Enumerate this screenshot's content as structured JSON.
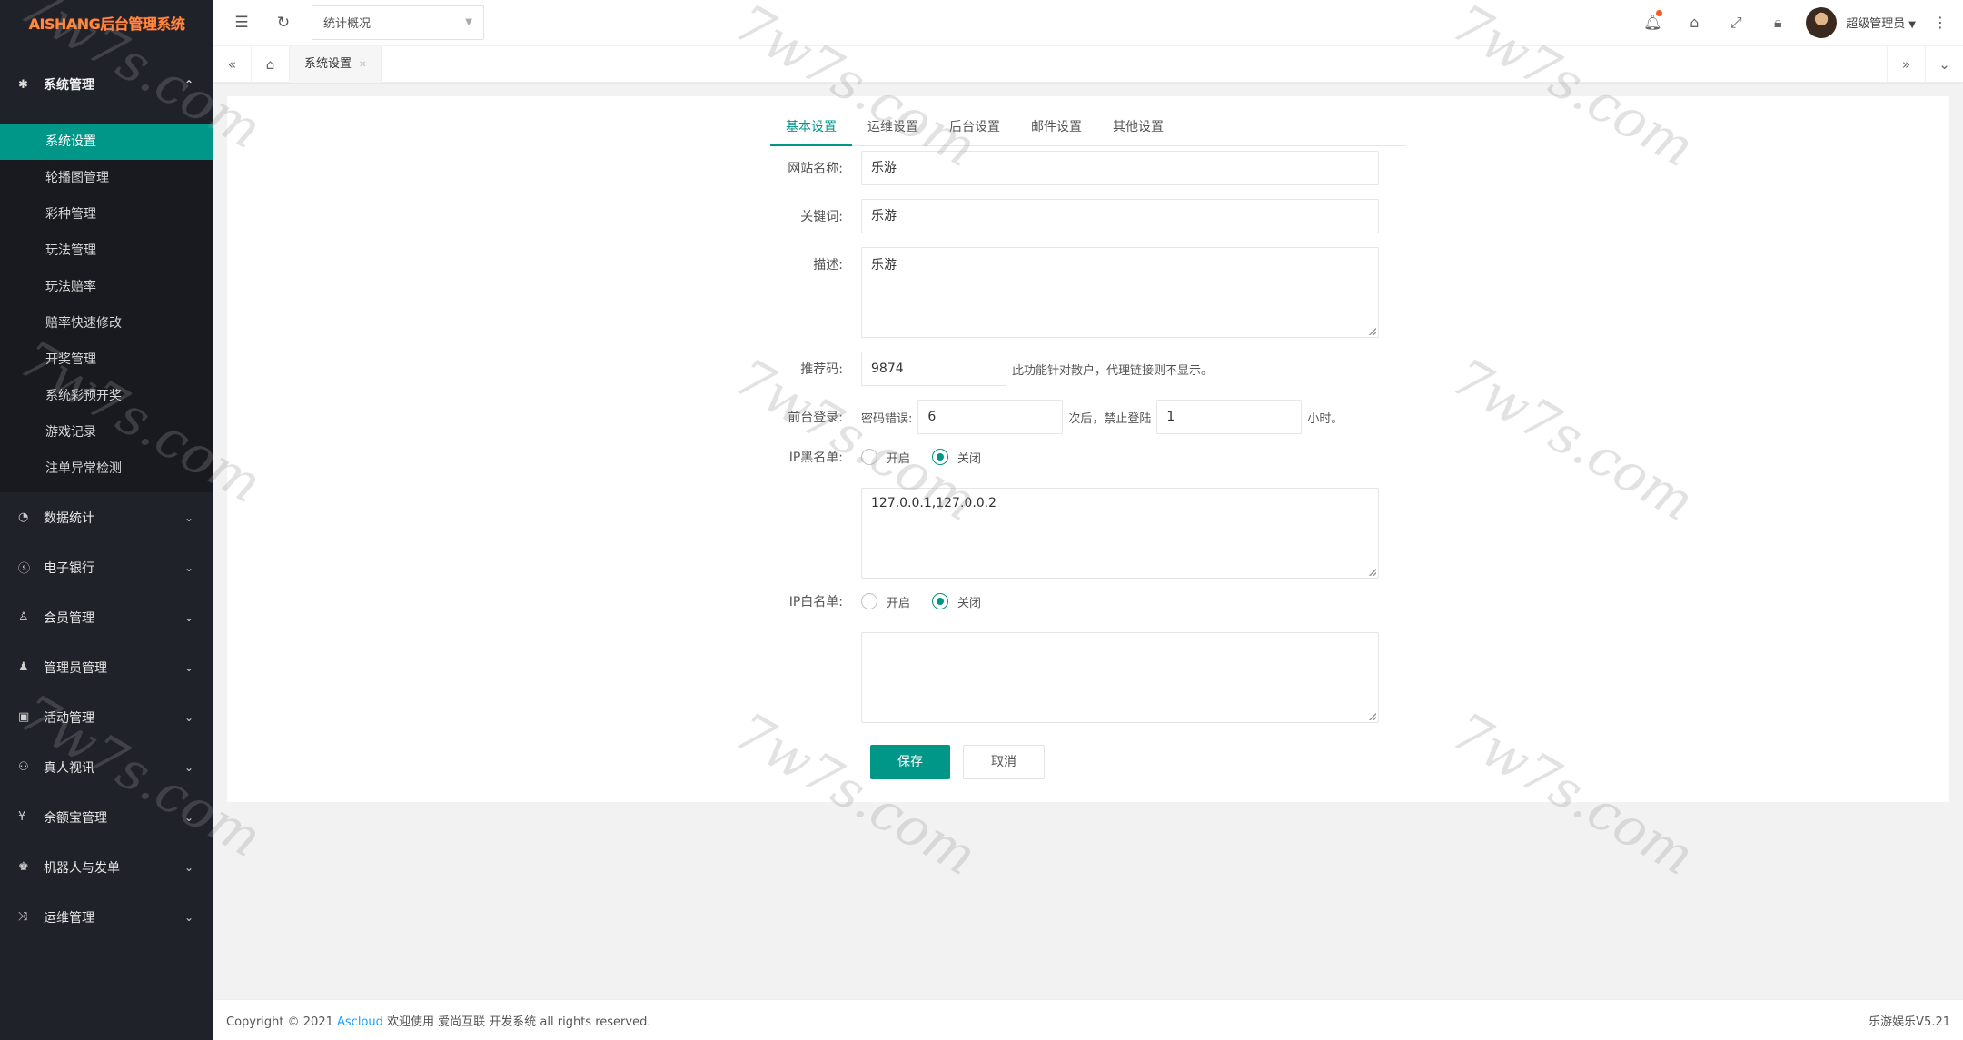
{
  "brand": {
    "logo_text": "AISHANG后台管理系统"
  },
  "sidebar": {
    "open_group": {
      "label": "系统管理",
      "icon": "gear-icon"
    },
    "sub_items": [
      {
        "label": "系统设置",
        "active": true
      },
      {
        "label": "轮播图管理"
      },
      {
        "label": "彩种管理"
      },
      {
        "label": "玩法管理"
      },
      {
        "label": "玩法赔率"
      },
      {
        "label": "赔率快速修改"
      },
      {
        "label": "开奖管理"
      },
      {
        "label": "系统彩预开奖"
      },
      {
        "label": "游戏记录"
      },
      {
        "label": "注单异常检测"
      }
    ],
    "groups": [
      {
        "label": "数据统计",
        "icon": "dashboard-icon"
      },
      {
        "label": "电子银行",
        "icon": "dollar-icon"
      },
      {
        "label": "会员管理",
        "icon": "users-icon"
      },
      {
        "label": "管理员管理",
        "icon": "user-icon"
      },
      {
        "label": "活动管理",
        "icon": "gift-icon"
      },
      {
        "label": "真人视讯",
        "icon": "group-icon"
      },
      {
        "label": "余额宝管理",
        "icon": "yen-icon"
      },
      {
        "label": "机器人与发单",
        "icon": "robot-icon"
      },
      {
        "label": "运维管理",
        "icon": "shuffle-icon"
      }
    ]
  },
  "header": {
    "select_value": "统计概况",
    "username": "超级管理员"
  },
  "tabbar": {
    "tab_label": "系统设置"
  },
  "form": {
    "tabs": [
      "基本设置",
      "运维设置",
      "后台设置",
      "邮件设置",
      "其他设置"
    ],
    "site_name": {
      "label": "网站名称:",
      "value": "乐游"
    },
    "keywords": {
      "label": "关键词:",
      "value": "乐游"
    },
    "description": {
      "label": "描述:",
      "value": "乐游"
    },
    "referral": {
      "label": "推荐码:",
      "value": "9874",
      "hint": "此功能针对散户，代理链接则不显示。"
    },
    "front_login": {
      "label": "前台登录:",
      "pwd_error_label": "密码错误:",
      "pwd_error_value": "6",
      "ban_label": "次后，禁止登陆",
      "ban_value": "1",
      "hours_label": "小时。"
    },
    "ip_blacklist": {
      "label": "IP黑名单:",
      "on_label": "开启",
      "off_label": "关闭",
      "selected": "off",
      "value": "127.0.0.1,127.0.0.2"
    },
    "ip_whitelist": {
      "label": "IP白名单:",
      "on_label": "开启",
      "off_label": "关闭",
      "selected": "off",
      "value": ""
    },
    "save_label": "保存",
    "cancel_label": "取消"
  },
  "footer": {
    "copyright_prefix": "Copyright © 2021",
    "link_text": "Ascloud",
    "copyright_suffix": "欢迎使用 爱尚互联 开发系统 all rights reserved.",
    "version": "乐游娱乐V5.21"
  },
  "watermark_text": "7w7s.com",
  "colors": {
    "accent": "#009688",
    "sidebar_bg": "#20222a",
    "link": "#1e9fff",
    "badge": "#ff5722"
  }
}
